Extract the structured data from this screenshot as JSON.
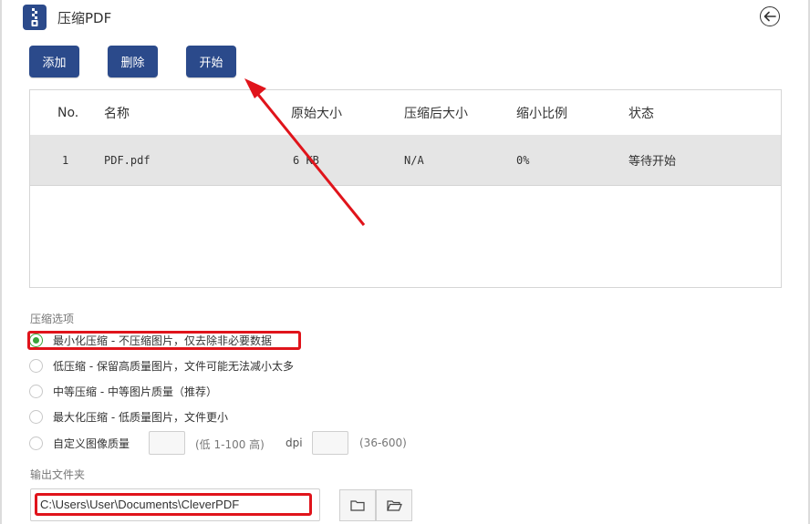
{
  "app": {
    "title": "压缩PDF"
  },
  "toolbar": {
    "add_label": "添加",
    "delete_label": "删除",
    "start_label": "开始"
  },
  "table": {
    "headers": [
      "No.",
      "名称",
      "原始大小",
      "压缩后大小",
      "缩小比例",
      "状态"
    ],
    "rows": [
      {
        "no": "1",
        "name": "PDF.pdf",
        "original_size": "6 KB",
        "compressed_size": "N/A",
        "ratio": "0%",
        "status": "等待开始"
      }
    ]
  },
  "options": {
    "label": "压缩选项",
    "items": [
      {
        "label": "最小化压缩 - 不压缩图片，仅去除非必要数据",
        "checked": true
      },
      {
        "label": "低压缩 - 保留高质量图片，文件可能无法减小太多",
        "checked": false
      },
      {
        "label": "中等压缩 - 中等图片质量（推荐）",
        "checked": false
      },
      {
        "label": "最大化压缩 - 低质量图片，文件更小",
        "checked": false
      },
      {
        "label": "自定义图像质量",
        "checked": false
      }
    ],
    "quality_hint": "(低 1-100 高)",
    "dpi_label": "dpi",
    "dpi_hint": "(36-600)"
  },
  "output": {
    "label": "输出文件夹",
    "path": "C:\\Users\\User\\Documents\\CleverPDF"
  },
  "colors": {
    "primary": "#2b4a8b",
    "annotation": "#e0141b",
    "selected_radio": "#3aa53a"
  }
}
